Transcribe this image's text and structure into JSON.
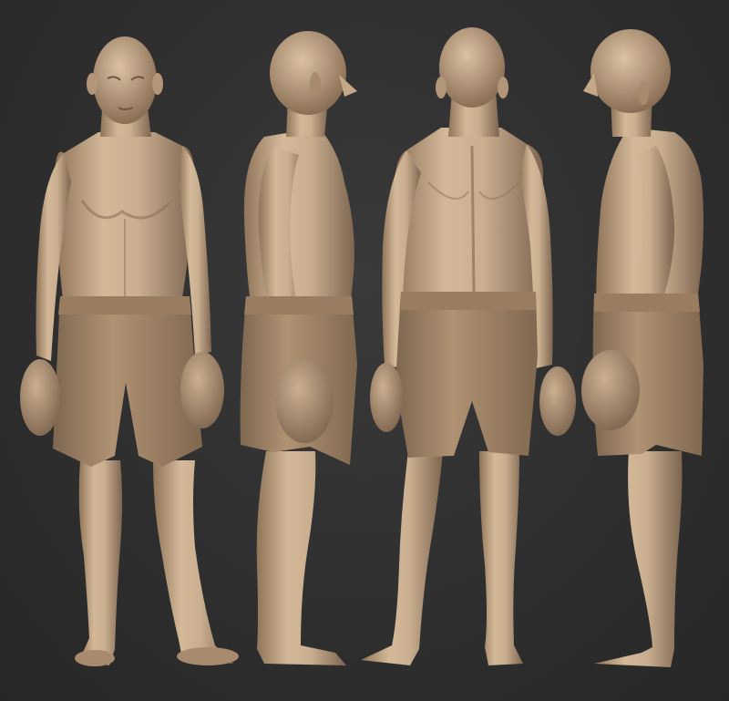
{
  "scene": {
    "background_color": "#2f2f2f",
    "skin_color": "#c9ae8f",
    "skin_shadow_color": "#8f7459",
    "shorts_color": "#a98a6b",
    "gloves_color": "#b59676",
    "views": [
      "front",
      "left-profile",
      "back",
      "right-profile"
    ]
  }
}
